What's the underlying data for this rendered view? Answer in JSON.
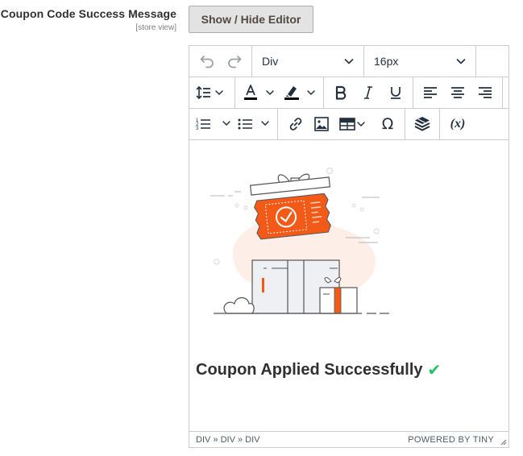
{
  "field": {
    "label": "Coupon Code Success Message",
    "scope": "[store view]",
    "toggle_label": "Show / Hide Editor"
  },
  "editor": {
    "toolbar": {
      "block_format": "Div",
      "font_size": "16px",
      "icons": [
        "undo-icon",
        "redo-icon",
        "line-height-icon",
        "text-color-icon",
        "highlight-color-icon",
        "bold-icon",
        "italic-icon",
        "underline-icon",
        "align-left-icon",
        "align-center-icon",
        "align-right-icon",
        "numbered-list-icon",
        "bullet-list-icon",
        "link-icon",
        "image-icon",
        "table-icon",
        "special-character-icon",
        "widget-icon",
        "variable-icon"
      ],
      "text_color": "#000000",
      "highlight_color": "#000000",
      "omega": "Ω",
      "variable": "(x)"
    },
    "content": {
      "message": "Coupon Applied Successfully",
      "check_mark": "✔",
      "check_color": "#22c55e",
      "accent_color": "#f35a17"
    },
    "statusbar": {
      "path": "DIV » DIV » DIV",
      "powered_by": "POWERED BY TINY"
    }
  }
}
